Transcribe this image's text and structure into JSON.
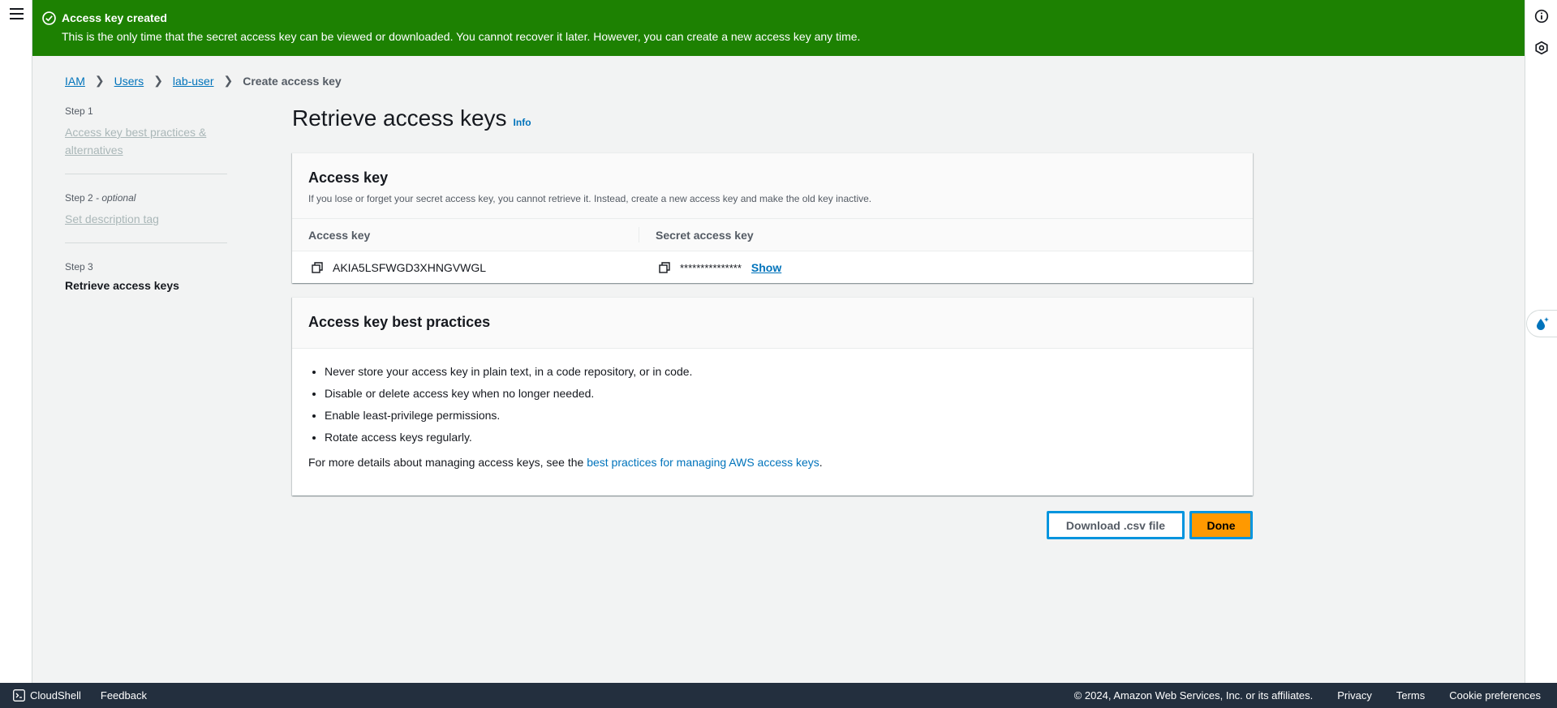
{
  "flash": {
    "title": "Access key created",
    "message": "This is the only time that the secret access key can be viewed or downloaded. You cannot recover it later. However, you can create a new access key any time.",
    "color": "#1d8102"
  },
  "breadcrumb": {
    "items": [
      "IAM",
      "Users",
      "lab-user"
    ],
    "current": "Create access key"
  },
  "steps": [
    {
      "num": "Step 1",
      "label": "Access key best practices & alternatives"
    },
    {
      "num": "Step 2",
      "optional": "- optional",
      "label": "Set description tag"
    },
    {
      "num": "Step 3",
      "label": "Retrieve access keys"
    }
  ],
  "page": {
    "title": "Retrieve access keys",
    "info": "Info"
  },
  "access_key_panel": {
    "title": "Access key",
    "description": "If you lose or forget your secret access key, you cannot retrieve it. Instead, create a new access key and make the old key inactive.",
    "col_access_key": "Access key",
    "col_secret": "Secret access key",
    "access_key_value": "AKIA5LSFWGD3XHNGVWGL",
    "secret_masked": "***************",
    "show_label": "Show"
  },
  "best_practices": {
    "title": "Access key best practices",
    "items": [
      "Never store your access key in plain text, in a code repository, or in code.",
      "Disable or delete access key when no longer needed.",
      "Enable least-privilege permissions.",
      "Rotate access keys regularly."
    ],
    "footer_prefix": "For more details about managing access keys, see the ",
    "footer_link": "best practices for managing AWS access keys",
    "footer_suffix": "."
  },
  "buttons": {
    "download": "Download .csv file",
    "done": "Done"
  },
  "footer": {
    "cloudshell": "CloudShell",
    "feedback": "Feedback",
    "copyright": "© 2024, Amazon Web Services, Inc. or its affiliates.",
    "privacy": "Privacy",
    "terms": "Terms",
    "cookies": "Cookie preferences"
  },
  "colors": {
    "accent": "#0073bb",
    "primary_button": "#ff9900",
    "focus_ring": "#0094de",
    "footer_bg": "#232f3e"
  }
}
